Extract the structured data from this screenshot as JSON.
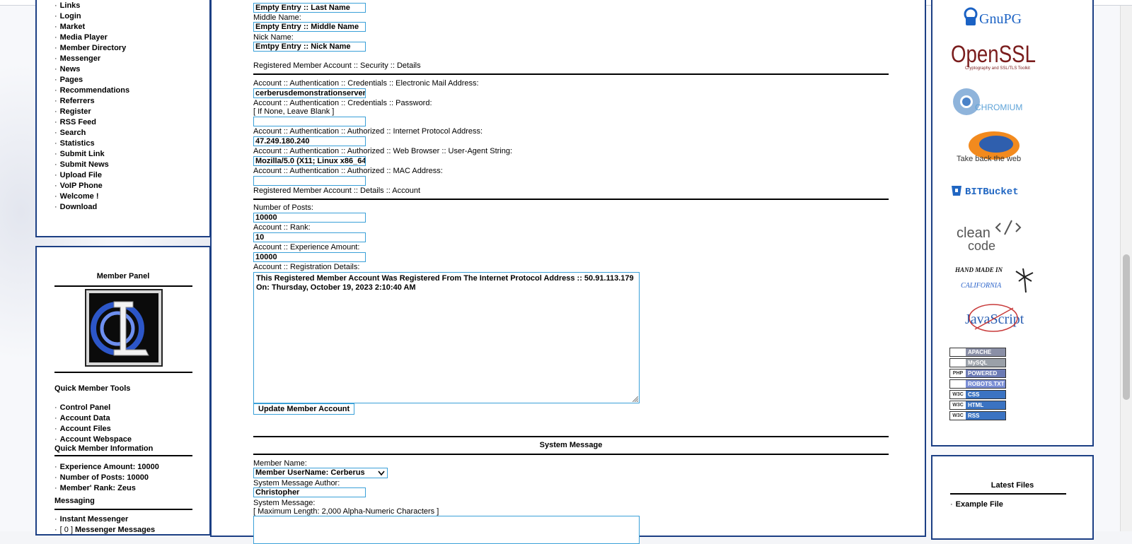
{
  "left_nav": {
    "items": [
      "Links",
      "Login",
      "Market",
      "Media Player",
      "Member Directory",
      "Messenger",
      "News",
      "Pages",
      "Recommendations",
      "Referrers",
      "Register",
      "RSS Feed",
      "Search",
      "Statistics",
      "Submit Link",
      "Submit News",
      "Upload File",
      "VoIP Phone",
      "Welcome !",
      "Download"
    ]
  },
  "member_panel": {
    "title": "Member Panel",
    "quick_tools_title": "Quick Member Tools",
    "quick_tools": [
      "Control Panel",
      "Account Data",
      "Account Files",
      "Account Webspace"
    ],
    "info_title": "Quick Member Information",
    "info": [
      "Experience Amount: 10000",
      "Number of Posts: 10000",
      "Member' Rank: Zeus"
    ],
    "messaging_title": "Messaging",
    "messaging": [
      {
        "prefix": "",
        "label": "Instant Messenger"
      },
      {
        "prefix": "[ 0 ]",
        "label": "Messenger Messages"
      }
    ]
  },
  "form": {
    "last_name_value": "Empty Entry :: Last Name",
    "middle_name_label": "Middle Name:",
    "middle_name_value": "Empty Entry :: Middle Name",
    "nick_name_label": "Nick Name:",
    "nick_name_value": "Emtpy Entry :: Nick Name",
    "security_section": "Registered Member Account :: Security :: Details",
    "email_label": "Account :: Authentication :: Credentials :: Electronic Mail Address:",
    "email_value": "cerberusdemonstrationserver",
    "password_label": "Account :: Authentication :: Credentials :: Password:",
    "password_hint": "[ If None, Leave Blank ]",
    "password_value": "",
    "ip_label": "Account :: Authentication :: Authorized :: Internet Protocol Address:",
    "ip_value": "47.249.180.240",
    "ua_label": "Account :: Authentication :: Authorized :: Web Browser :: User-Agent String:",
    "ua_value": "Mozilla/5.0 (X11; Linux x86_64",
    "mac_label": "Account :: Authentication :: Authorized :: MAC Address:",
    "mac_value": "",
    "details_section": "Registered Member Account :: Details :: Account",
    "posts_label": "Number of Posts:",
    "posts_value": "10000",
    "rank_label": "Account :: Rank:",
    "rank_value": "10",
    "exp_label": "Account :: Experience Amount:",
    "exp_value": "10000",
    "reg_label": "Account :: Registration Details:",
    "reg_line1": "This Registered Member Account Was Registered From The Internet Protocol Address :: 50.91.113.179",
    "reg_line2": "On: Thursday, October 19, 2023 2:10:40 AM",
    "update_button": "Update Member Account"
  },
  "system_message": {
    "title": "System Message",
    "member_name_label": "Member Name:",
    "member_select": "Member UserName: Cerberus",
    "author_label": "System Message Author:",
    "author_value": "Christopher",
    "message_label": "System Message:",
    "message_hint": "[ Maximum Length: 2,000 Alpha-Numeric Characters ]"
  },
  "right_panel": {
    "logos": [
      "GnuPG",
      "OpenSSL",
      "Cryptography and SSL/TLS Toolkit",
      "CHROMIUM",
      "Take back the web",
      "BITBucket",
      "clean",
      "code",
      "HAND MADE IN",
      "CALIFORNIA",
      "JavaScript"
    ],
    "badges": [
      {
        "left": "",
        "right": "APACHE",
        "color": "#8a8fa6"
      },
      {
        "left": "",
        "right": "MySQL",
        "color": "#9aa0a8"
      },
      {
        "left": "PHP",
        "right": "POWERED",
        "color": "#6c7bb5"
      },
      {
        "left": "",
        "right": "ROBOTS.TXT",
        "color": "#7b8fd6"
      },
      {
        "left": "W3C",
        "right": "CSS",
        "color": "#3b73c2"
      },
      {
        "left": "W3C",
        "right": "HTML",
        "color": "#3b73c2"
      },
      {
        "left": "W3C",
        "right": "RSS",
        "color": "#3b73c2"
      }
    ],
    "latest_files_title": "Latest Files",
    "latest_files": [
      "Example File"
    ]
  }
}
